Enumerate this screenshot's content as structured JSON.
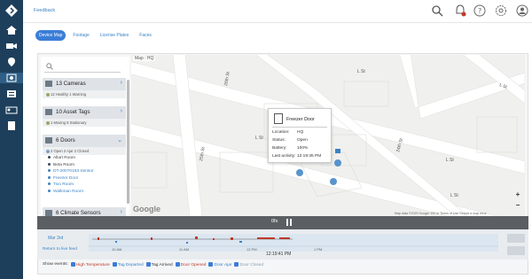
{
  "topbar": {
    "feedback_label": "Feedback"
  },
  "tabs": [
    {
      "label": "Device Map",
      "active": true
    },
    {
      "label": "Footage",
      "active": false
    },
    {
      "label": "License Plates",
      "active": false
    },
    {
      "label": "Faces",
      "active": false
    }
  ],
  "sidebar": {
    "search_placeholder": "",
    "groups": [
      {
        "title": "13 Cameras",
        "sub": "12 Healthy   1 Warning"
      },
      {
        "title": "10 Asset Tags",
        "sub": "1 Moving   9 Stationary"
      },
      {
        "title": "6 Doors",
        "sub": "2 Open   2 Ajar   2 Closed",
        "items": [
          {
            "label": "Allart Room",
            "link": false
          },
          {
            "label": "Beta Room",
            "link": false
          },
          {
            "label": "DT-20070153 Sensor",
            "link": true
          },
          {
            "label": "Freezer Door",
            "link": true
          },
          {
            "label": "Tivo Room",
            "link": true
          },
          {
            "label": "Walkman Room",
            "link": true
          }
        ]
      },
      {
        "title": "6 Climate Sensors",
        "sub": ""
      }
    ]
  },
  "map": {
    "label": "Map : HQ",
    "streets": [
      "L St",
      "L St",
      "L St",
      "26th St",
      "25th St",
      "24th St",
      "L St",
      "L St"
    ],
    "popup": {
      "title": "Freezer Door",
      "rows": [
        {
          "key": "Location:",
          "value": "HQ"
        },
        {
          "key": "Status:",
          "value": "Open"
        },
        {
          "key": "Battery:",
          "value": "100%"
        },
        {
          "key": "Last activity:",
          "value": "12:19:35 PM"
        }
      ]
    },
    "google": "Google",
    "footer": "Map data ©2020 Google   100 m   Terms of Use   Report a map error"
  },
  "timeline": {
    "bar_label": "0fx",
    "month_label": "Mar 3rd",
    "return_label": "Return to live feed",
    "timestamp": "12:19:41 PM",
    "tick_labels": [
      "10 AM",
      "11 AM",
      "12 PM",
      "1 PM"
    ]
  },
  "events": {
    "label": "Show events:",
    "items": [
      {
        "label": "High Temperature",
        "color": "#c0392b"
      },
      {
        "label": "Tag Departed",
        "color": "#3b82c4"
      },
      {
        "label": "Tag Arrived",
        "color": "#333333"
      },
      {
        "label": "Door Opened",
        "color": "#c0392b"
      },
      {
        "label": "Door Ajar",
        "color": "#3b82c4"
      },
      {
        "label": "Door Closed",
        "color": "#8aa0b3"
      }
    ]
  },
  "colors": {
    "rail": "#1d3f5c",
    "accent": "#3b7dd8",
    "alert": "#c0392b"
  }
}
